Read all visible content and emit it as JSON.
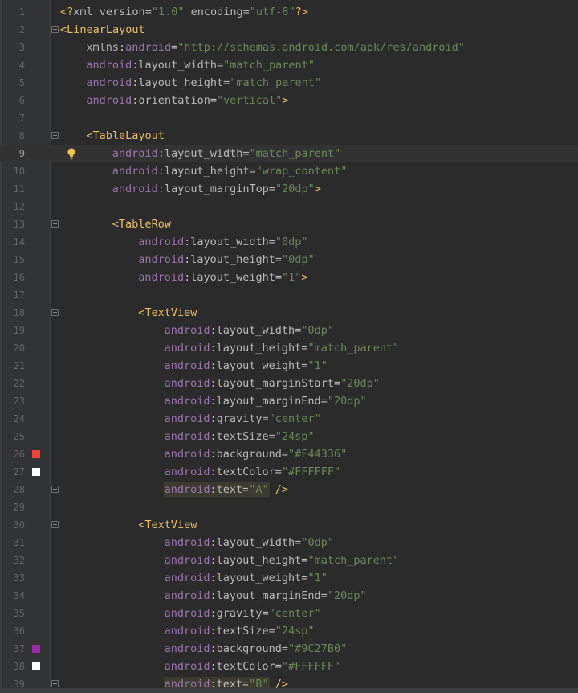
{
  "editor": {
    "current_line": 9,
    "lines": [
      {
        "n": "1",
        "indent": 0,
        "tokens": [
          {
            "t": "<?",
            "c": "pi"
          },
          {
            "t": "xml ",
            "c": "plain"
          },
          {
            "t": "version",
            "c": "plain"
          },
          {
            "t": "=",
            "c": "plain"
          },
          {
            "t": "\"1.0\"",
            "c": "val"
          },
          {
            "t": " encoding",
            "c": "plain"
          },
          {
            "t": "=",
            "c": "plain"
          },
          {
            "t": "\"utf-8\"",
            "c": "val"
          },
          {
            "t": "?>",
            "c": "pi"
          }
        ]
      },
      {
        "n": "2",
        "indent": 0,
        "fold": true,
        "tokens": [
          {
            "t": "<LinearLayout",
            "c": "tag"
          }
        ]
      },
      {
        "n": "3",
        "indent": 4,
        "tokens": [
          {
            "t": "xmlns",
            "c": "plain"
          },
          {
            "t": ":",
            "c": "plain"
          },
          {
            "t": "android",
            "c": "ns"
          },
          {
            "t": "=",
            "c": "plain"
          },
          {
            "t": "\"http://schemas.android.com/apk/res/android\"",
            "c": "val"
          }
        ]
      },
      {
        "n": "4",
        "indent": 4,
        "tokens": [
          {
            "t": "android",
            "c": "ns"
          },
          {
            "t": ":layout_width",
            "c": "attr"
          },
          {
            "t": "=",
            "c": "plain"
          },
          {
            "t": "\"match_parent\"",
            "c": "val"
          }
        ]
      },
      {
        "n": "5",
        "indent": 4,
        "tokens": [
          {
            "t": "android",
            "c": "ns"
          },
          {
            "t": ":layout_height",
            "c": "attr"
          },
          {
            "t": "=",
            "c": "plain"
          },
          {
            "t": "\"match_parent\"",
            "c": "val"
          }
        ]
      },
      {
        "n": "6",
        "indent": 4,
        "tokens": [
          {
            "t": "android",
            "c": "ns"
          },
          {
            "t": ":orientation",
            "c": "attr"
          },
          {
            "t": "=",
            "c": "plain"
          },
          {
            "t": "\"vertical\"",
            "c": "val"
          },
          {
            "t": ">",
            "c": "punct"
          }
        ]
      },
      {
        "n": "7",
        "indent": 0,
        "tokens": []
      },
      {
        "n": "8",
        "indent": 4,
        "fold": true,
        "tokens": [
          {
            "t": "<TableLayout",
            "c": "tag"
          }
        ]
      },
      {
        "n": "9",
        "indent": 8,
        "bulb": true,
        "tokens": [
          {
            "t": "android",
            "c": "ns"
          },
          {
            "t": ":layout_width",
            "c": "attr"
          },
          {
            "t": "=",
            "c": "plain"
          },
          {
            "t": "\"match_parent\"",
            "c": "val"
          }
        ]
      },
      {
        "n": "10",
        "indent": 8,
        "tokens": [
          {
            "t": "android",
            "c": "ns"
          },
          {
            "t": ":layout_height",
            "c": "attr"
          },
          {
            "t": "=",
            "c": "plain"
          },
          {
            "t": "\"wrap_content\"",
            "c": "val"
          }
        ]
      },
      {
        "n": "11",
        "indent": 8,
        "tokens": [
          {
            "t": "android",
            "c": "ns"
          },
          {
            "t": ":layout_marginTop",
            "c": "attr"
          },
          {
            "t": "=",
            "c": "plain"
          },
          {
            "t": "\"20dp\"",
            "c": "val"
          },
          {
            "t": ">",
            "c": "punct"
          }
        ]
      },
      {
        "n": "12",
        "indent": 0,
        "tokens": []
      },
      {
        "n": "13",
        "indent": 8,
        "fold": true,
        "tokens": [
          {
            "t": "<TableRow",
            "c": "tag"
          }
        ]
      },
      {
        "n": "14",
        "indent": 12,
        "tokens": [
          {
            "t": "android",
            "c": "ns"
          },
          {
            "t": ":layout_width",
            "c": "attr"
          },
          {
            "t": "=",
            "c": "plain"
          },
          {
            "t": "\"0dp\"",
            "c": "val"
          }
        ]
      },
      {
        "n": "15",
        "indent": 12,
        "tokens": [
          {
            "t": "android",
            "c": "ns"
          },
          {
            "t": ":layout_height",
            "c": "attr"
          },
          {
            "t": "=",
            "c": "plain"
          },
          {
            "t": "\"0dp\"",
            "c": "val"
          }
        ]
      },
      {
        "n": "16",
        "indent": 12,
        "tokens": [
          {
            "t": "android",
            "c": "ns"
          },
          {
            "t": ":layout_weight",
            "c": "attr"
          },
          {
            "t": "=",
            "c": "plain"
          },
          {
            "t": "\"1\"",
            "c": "val"
          },
          {
            "t": ">",
            "c": "punct"
          }
        ]
      },
      {
        "n": "17",
        "indent": 0,
        "tokens": []
      },
      {
        "n": "18",
        "indent": 12,
        "fold": true,
        "tokens": [
          {
            "t": "<TextView",
            "c": "tag"
          }
        ]
      },
      {
        "n": "19",
        "indent": 16,
        "tokens": [
          {
            "t": "android",
            "c": "ns"
          },
          {
            "t": ":layout_width",
            "c": "attr"
          },
          {
            "t": "=",
            "c": "plain"
          },
          {
            "t": "\"0dp\"",
            "c": "val"
          }
        ]
      },
      {
        "n": "20",
        "indent": 16,
        "tokens": [
          {
            "t": "android",
            "c": "ns"
          },
          {
            "t": ":layout_height",
            "c": "attr"
          },
          {
            "t": "=",
            "c": "plain"
          },
          {
            "t": "\"match_parent\"",
            "c": "val"
          }
        ]
      },
      {
        "n": "21",
        "indent": 16,
        "tokens": [
          {
            "t": "android",
            "c": "ns"
          },
          {
            "t": ":layout_weight",
            "c": "attr"
          },
          {
            "t": "=",
            "c": "plain"
          },
          {
            "t": "\"1\"",
            "c": "val"
          }
        ]
      },
      {
        "n": "22",
        "indent": 16,
        "tokens": [
          {
            "t": "android",
            "c": "ns"
          },
          {
            "t": ":layout_marginStart",
            "c": "attr"
          },
          {
            "t": "=",
            "c": "plain"
          },
          {
            "t": "\"20dp\"",
            "c": "val"
          }
        ]
      },
      {
        "n": "23",
        "indent": 16,
        "tokens": [
          {
            "t": "android",
            "c": "ns"
          },
          {
            "t": ":layout_marginEnd",
            "c": "attr"
          },
          {
            "t": "=",
            "c": "plain"
          },
          {
            "t": "\"20dp\"",
            "c": "val"
          }
        ]
      },
      {
        "n": "24",
        "indent": 16,
        "tokens": [
          {
            "t": "android",
            "c": "ns"
          },
          {
            "t": ":gravity",
            "c": "attr"
          },
          {
            "t": "=",
            "c": "plain"
          },
          {
            "t": "\"center\"",
            "c": "val"
          }
        ]
      },
      {
        "n": "25",
        "indent": 16,
        "tokens": [
          {
            "t": "android",
            "c": "ns"
          },
          {
            "t": ":textSize",
            "c": "attr"
          },
          {
            "t": "=",
            "c": "plain"
          },
          {
            "t": "\"24sp\"",
            "c": "val"
          }
        ]
      },
      {
        "n": "26",
        "indent": 16,
        "swatch": "#F44336",
        "tokens": [
          {
            "t": "android",
            "c": "ns"
          },
          {
            "t": ":background",
            "c": "attr"
          },
          {
            "t": "=",
            "c": "plain"
          },
          {
            "t": "\"#F44336\"",
            "c": "val"
          }
        ]
      },
      {
        "n": "27",
        "indent": 16,
        "swatch": "#FFFFFF",
        "tokens": [
          {
            "t": "android",
            "c": "ns"
          },
          {
            "t": ":textColor",
            "c": "attr"
          },
          {
            "t": "=",
            "c": "plain"
          },
          {
            "t": "\"#FFFFFF\"",
            "c": "val"
          }
        ]
      },
      {
        "n": "28",
        "indent": 16,
        "fold": true,
        "tokens": [
          {
            "t": "android",
            "c": "ns",
            "hl": true
          },
          {
            "t": ":text",
            "c": "attr",
            "hl": true
          },
          {
            "t": "=",
            "c": "plain",
            "hl": true
          },
          {
            "t": "\"A\"",
            "c": "val",
            "hl": true
          },
          {
            "t": " />",
            "c": "punct"
          }
        ]
      },
      {
        "n": "29",
        "indent": 0,
        "tokens": []
      },
      {
        "n": "30",
        "indent": 12,
        "fold": true,
        "tokens": [
          {
            "t": "<TextView",
            "c": "tag"
          }
        ]
      },
      {
        "n": "31",
        "indent": 16,
        "tokens": [
          {
            "t": "android",
            "c": "ns"
          },
          {
            "t": ":layout_width",
            "c": "attr"
          },
          {
            "t": "=",
            "c": "plain"
          },
          {
            "t": "\"0dp\"",
            "c": "val"
          }
        ]
      },
      {
        "n": "32",
        "indent": 16,
        "tokens": [
          {
            "t": "android",
            "c": "ns"
          },
          {
            "t": ":layout_height",
            "c": "attr"
          },
          {
            "t": "=",
            "c": "plain"
          },
          {
            "t": "\"match_parent\"",
            "c": "val"
          }
        ]
      },
      {
        "n": "33",
        "indent": 16,
        "tokens": [
          {
            "t": "android",
            "c": "ns"
          },
          {
            "t": ":layout_weight",
            "c": "attr"
          },
          {
            "t": "=",
            "c": "plain"
          },
          {
            "t": "\"1\"",
            "c": "val"
          }
        ]
      },
      {
        "n": "34",
        "indent": 16,
        "tokens": [
          {
            "t": "android",
            "c": "ns"
          },
          {
            "t": ":layout_marginEnd",
            "c": "attr"
          },
          {
            "t": "=",
            "c": "plain"
          },
          {
            "t": "\"20dp\"",
            "c": "val"
          }
        ]
      },
      {
        "n": "35",
        "indent": 16,
        "tokens": [
          {
            "t": "android",
            "c": "ns"
          },
          {
            "t": ":gravity",
            "c": "attr"
          },
          {
            "t": "=",
            "c": "plain"
          },
          {
            "t": "\"center\"",
            "c": "val"
          }
        ]
      },
      {
        "n": "36",
        "indent": 16,
        "tokens": [
          {
            "t": "android",
            "c": "ns"
          },
          {
            "t": ":textSize",
            "c": "attr"
          },
          {
            "t": "=",
            "c": "plain"
          },
          {
            "t": "\"24sp\"",
            "c": "val"
          }
        ]
      },
      {
        "n": "37",
        "indent": 16,
        "swatch": "#9C27B0",
        "tokens": [
          {
            "t": "android",
            "c": "ns"
          },
          {
            "t": ":background",
            "c": "attr"
          },
          {
            "t": "=",
            "c": "plain"
          },
          {
            "t": "\"#9C27B0\"",
            "c": "val"
          }
        ]
      },
      {
        "n": "38",
        "indent": 16,
        "swatch": "#FFFFFF",
        "tokens": [
          {
            "t": "android",
            "c": "ns"
          },
          {
            "t": ":textColor",
            "c": "attr"
          },
          {
            "t": "=",
            "c": "plain"
          },
          {
            "t": "\"#FFFFFF\"",
            "c": "val"
          }
        ]
      },
      {
        "n": "39",
        "indent": 16,
        "fold": true,
        "tokens": [
          {
            "t": "android",
            "c": "ns",
            "hl": true
          },
          {
            "t": ":text",
            "c": "attr",
            "hl": true
          },
          {
            "t": "=",
            "c": "plain",
            "hl": true
          },
          {
            "t": "\"B\"",
            "c": "val",
            "hl": true
          },
          {
            "t": " />",
            "c": "punct"
          }
        ]
      }
    ]
  }
}
